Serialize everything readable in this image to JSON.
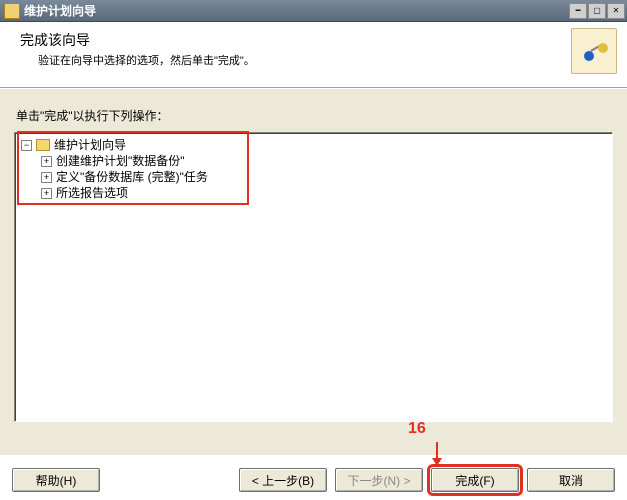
{
  "window": {
    "title": "维护计划向导"
  },
  "header": {
    "title": "完成该向导",
    "subtitle": "验证在向导中选择的选项，然后单击\"完成\"。"
  },
  "instruction": "单击\"完成\"以执行下列操作：",
  "tree": {
    "root": "维护计划向导",
    "children": [
      "创建维护计划\"数据备份\"",
      "定义\"备份数据库 (完整)\"任务",
      "所选报告选项"
    ]
  },
  "buttons": {
    "help": "帮助(H)",
    "back": "< 上一步(B)",
    "next": "下一步(N) >",
    "finish": "完成(F)",
    "cancel": "取消"
  },
  "annotation": {
    "label": "16"
  }
}
